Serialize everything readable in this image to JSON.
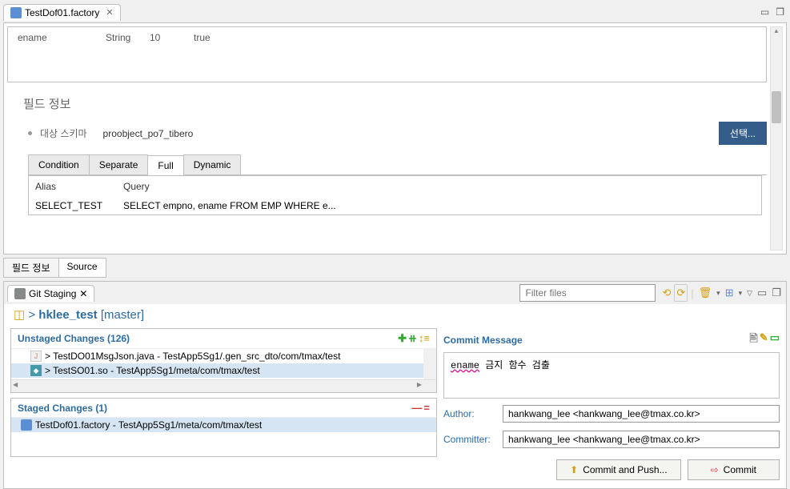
{
  "editor": {
    "tab_title": "TestDof01.factory",
    "grid": {
      "c1": "ename",
      "c2": "String",
      "c3": "10",
      "c4": "true"
    }
  },
  "field_info": {
    "title": "필드 정보",
    "schema_label": "대상 스키마",
    "schema_value": "proobject_po7_tibero",
    "select_btn": "선택..."
  },
  "query_tabs": {
    "condition": "Condition",
    "separate": "Separate",
    "full": "Full",
    "dynamic": "Dynamic"
  },
  "query_table": {
    "h_alias": "Alias",
    "h_query": "Query",
    "r_alias": "SELECT_TEST",
    "r_query": "SELECT empno, ename FROM EMP WHERE e..."
  },
  "bottom_tabs": {
    "field": "필드 정보",
    "source": "Source"
  },
  "git": {
    "tab_title": "Git Staging",
    "filter_placeholder": "Filter files",
    "repo_name": "hklee_test",
    "repo_branch": "[master]"
  },
  "unstaged": {
    "title": "Unstaged Changes (126)",
    "file1": "> TestDO01MsgJson.java - TestApp5Sg1/.gen_src_dto/com/tmax/test",
    "file2": "> TestSO01.so - TestApp5Sg1/meta/com/tmax/test"
  },
  "staged": {
    "title": "Staged Changes (1)",
    "file1": "TestDof01.factory - TestApp5Sg1/meta/com/tmax/test"
  },
  "commit": {
    "title": "Commit Message",
    "msg_word": "ename",
    "msg_rest": "  금지 함수 검출",
    "author_label": "Author:",
    "committer_label": "Committer:",
    "author_value": "hankwang_lee <hankwang_lee@tmax.co.kr>",
    "committer_value": "hankwang_lee <hankwang_lee@tmax.co.kr>",
    "push_btn": "Commit and Push...",
    "commit_btn": "Commit"
  }
}
